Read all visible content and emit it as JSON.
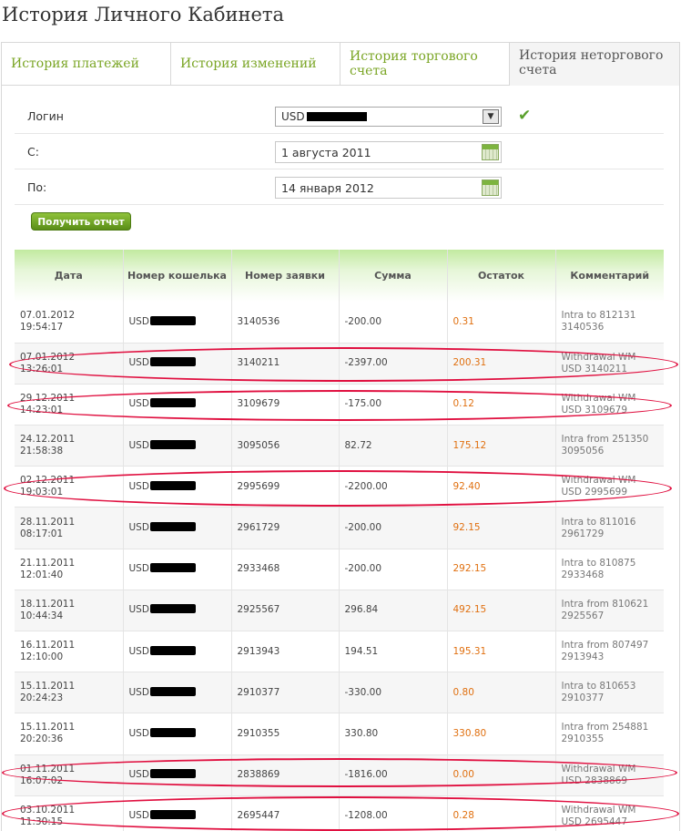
{
  "page": {
    "title": "История Личного Кабинета"
  },
  "tabs": [
    {
      "label": "История платежей"
    },
    {
      "label": "История изменений"
    },
    {
      "label": "История торгового счета"
    },
    {
      "label": "История неторгового счета"
    }
  ],
  "form": {
    "login_label": "Логин",
    "login_value": "USD",
    "from_label": "С:",
    "from_value": "1 августа 2011",
    "to_label": "По:",
    "to_value": "14 января 2012",
    "report_button": "Получить отчет"
  },
  "table": {
    "headers": [
      "Дата",
      "Номер кошелька",
      "Номер заявки",
      "Сумма",
      "Остаток",
      "Комментарий"
    ],
    "rows": [
      {
        "date": "07.01.2012 19:54:17",
        "wallet": "USD",
        "request": "3140536",
        "amount": "-200.00",
        "balance": "0.31",
        "comment": "Intra to 812131 3140536"
      },
      {
        "date": "07.01.2012 13:26:01",
        "wallet": "USD",
        "request": "3140211",
        "amount": "-2397.00",
        "balance": "200.31",
        "comment": "Withdrawal WM USD 3140211"
      },
      {
        "date": "29.12.2011 14:23:01",
        "wallet": "USD",
        "request": "3109679",
        "amount": "-175.00",
        "balance": "0.12",
        "comment": "Withdrawal WM USD 3109679"
      },
      {
        "date": "24.12.2011 21:58:38",
        "wallet": "USD",
        "request": "3095056",
        "amount": "82.72",
        "balance": "175.12",
        "comment": "Intra from 251350 3095056"
      },
      {
        "date": "02.12.2011 19:03:01",
        "wallet": "USD",
        "request": "2995699",
        "amount": "-2200.00",
        "balance": "92.40",
        "comment": "Withdrawal WM USD 2995699"
      },
      {
        "date": "28.11.2011 08:17:01",
        "wallet": "USD",
        "request": "2961729",
        "amount": "-200.00",
        "balance": "92.15",
        "comment": "Intra to 811016 2961729"
      },
      {
        "date": "21.11.2011 12:01:40",
        "wallet": "USD",
        "request": "2933468",
        "amount": "-200.00",
        "balance": "292.15",
        "comment": "Intra to 810875 2933468"
      },
      {
        "date": "18.11.2011 10:44:34",
        "wallet": "USD",
        "request": "2925567",
        "amount": "296.84",
        "balance": "492.15",
        "comment": "Intra from 810621 2925567"
      },
      {
        "date": "16.11.2011 12:10:00",
        "wallet": "USD",
        "request": "2913943",
        "amount": "194.51",
        "balance": "195.31",
        "comment": "Intra from 807497 2913943"
      },
      {
        "date": "15.11.2011 20:24:23",
        "wallet": "USD",
        "request": "2910377",
        "amount": "-330.00",
        "balance": "0.80",
        "comment": "Intra to 810653 2910377"
      },
      {
        "date": "15.11.2011 20:20:36",
        "wallet": "USD",
        "request": "2910355",
        "amount": "330.80",
        "balance": "330.80",
        "comment": "Intra from 254881 2910355"
      },
      {
        "date": "01.11.2011 16:07:02",
        "wallet": "USD",
        "request": "2838869",
        "amount": "-1816.00",
        "balance": "0.00",
        "comment": "Withdrawal WM USD 2838869"
      },
      {
        "date": "03.10.2011 11:30:15",
        "wallet": "USD",
        "request": "2695447",
        "amount": "-1208.00",
        "balance": "0.28",
        "comment": "Withdrawal WM USD 2695447"
      }
    ]
  }
}
